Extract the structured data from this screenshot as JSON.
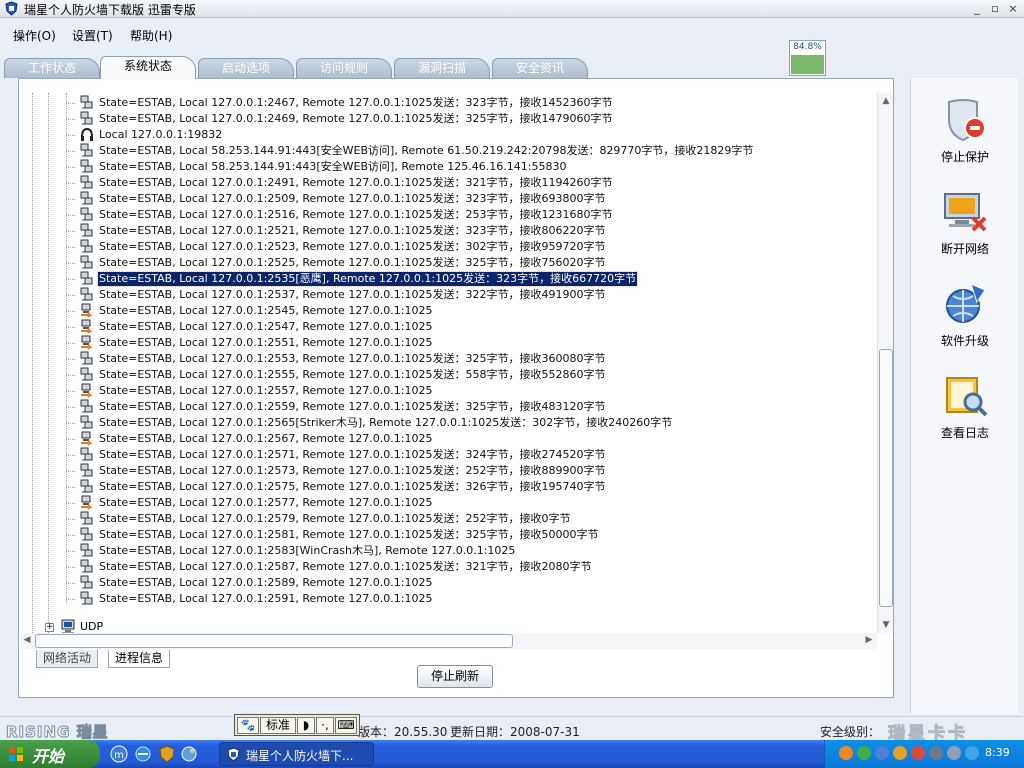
{
  "window": {
    "title": "瑞星个人防火墙下载版 迅雷专版",
    "min_label": "_",
    "max_label": "▫",
    "close_label": "×"
  },
  "menu": [
    "操作(O)",
    "设置(T)",
    "帮助(H)"
  ],
  "cpu_meter": {
    "label": "84.8%",
    "level_percent": 84.8
  },
  "tabs": [
    {
      "label": "工作状态",
      "active": false
    },
    {
      "label": "系统状态",
      "active": true
    },
    {
      "label": "启动选项",
      "active": false
    },
    {
      "label": "访问规则",
      "active": false
    },
    {
      "label": "漏洞扫描",
      "active": false
    },
    {
      "label": "安全资讯",
      "active": false
    }
  ],
  "connections": [
    {
      "icon": "connection",
      "text": "State=ESTAB, Local 127.0.0.1:2467, Remote 127.0.0.1:1025发送：323字节，接收1452360字节"
    },
    {
      "icon": "connection",
      "text": "State=ESTAB, Local 127.0.0.1:2469, Remote 127.0.0.1:1025发送：325字节，接收1479060字节"
    },
    {
      "icon": "listening",
      "text": "Local 127.0.0.1:19832"
    },
    {
      "icon": "connection",
      "text": "State=ESTAB, Local 58.253.144.91:443[安全WEB访问], Remote 61.50.219.242:20798发送：829770字节，接收21829字节"
    },
    {
      "icon": "connection",
      "text": "State=ESTAB, Local 58.253.144.91:443[安全WEB访问], Remote 125.46.16.141:55830"
    },
    {
      "icon": "connection",
      "text": "State=ESTAB, Local 127.0.0.1:2491, Remote 127.0.0.1:1025发送：321字节，接收1194260字节"
    },
    {
      "icon": "connection",
      "text": "State=ESTAB, Local 127.0.0.1:2509, Remote 127.0.0.1:1025发送：323字节，接收693800字节"
    },
    {
      "icon": "connection",
      "text": "State=ESTAB, Local 127.0.0.1:2516, Remote 127.0.0.1:1025发送：253字节，接收1231680字节"
    },
    {
      "icon": "connection",
      "text": "State=ESTAB, Local 127.0.0.1:2521, Remote 127.0.0.1:1025发送：323字节，接收806220字节"
    },
    {
      "icon": "connection",
      "text": "State=ESTAB, Local 127.0.0.1:2523, Remote 127.0.0.1:1025发送：302字节，接收959720字节"
    },
    {
      "icon": "connection",
      "text": "State=ESTAB, Local 127.0.0.1:2525, Remote 127.0.0.1:1025发送：325字节，接收756020字节"
    },
    {
      "icon": "connection",
      "text": "State=ESTAB, Local 127.0.0.1:2535[恶鹰], Remote 127.0.0.1:1025发送：323字节，接收667720字节",
      "selected": true
    },
    {
      "icon": "connection",
      "text": "State=ESTAB, Local 127.0.0.1:2537, Remote 127.0.0.1:1025发送：322字节，接收491900字节"
    },
    {
      "icon": "outgoing",
      "text": "State=ESTAB, Local 127.0.0.1:2545, Remote 127.0.0.1:1025"
    },
    {
      "icon": "outgoing",
      "text": "State=ESTAB, Local 127.0.0.1:2547, Remote 127.0.0.1:1025"
    },
    {
      "icon": "outgoing",
      "text": "State=ESTAB, Local 127.0.0.1:2551, Remote 127.0.0.1:1025"
    },
    {
      "icon": "connection",
      "text": "State=ESTAB, Local 127.0.0.1:2553, Remote 127.0.0.1:1025发送：325字节，接收360080字节"
    },
    {
      "icon": "connection",
      "text": "State=ESTAB, Local 127.0.0.1:2555, Remote 127.0.0.1:1025发送：558字节，接收552860字节"
    },
    {
      "icon": "outgoing",
      "text": "State=ESTAB, Local 127.0.0.1:2557, Remote 127.0.0.1:1025"
    },
    {
      "icon": "connection",
      "text": "State=ESTAB, Local 127.0.0.1:2559, Remote 127.0.0.1:1025发送：325字节，接收483120字节"
    },
    {
      "icon": "connection",
      "text": "State=ESTAB, Local 127.0.0.1:2565[Striker木马], Remote 127.0.0.1:1025发送：302字节，接收240260字节"
    },
    {
      "icon": "outgoing",
      "text": "State=ESTAB, Local 127.0.0.1:2567, Remote 127.0.0.1:1025"
    },
    {
      "icon": "connection",
      "text": "State=ESTAB, Local 127.0.0.1:2571, Remote 127.0.0.1:1025发送：324字节，接收274520字节"
    },
    {
      "icon": "connection",
      "text": "State=ESTAB, Local 127.0.0.1:2573, Remote 127.0.0.1:1025发送：252字节，接收889900字节"
    },
    {
      "icon": "connection",
      "text": "State=ESTAB, Local 127.0.0.1:2575, Remote 127.0.0.1:1025发送：326字节，接收195740字节"
    },
    {
      "icon": "outgoing",
      "text": "State=ESTAB, Local 127.0.0.1:2577, Remote 127.0.0.1:1025"
    },
    {
      "icon": "connection",
      "text": "State=ESTAB, Local 127.0.0.1:2579, Remote 127.0.0.1:1025发送：252字节，接收0字节"
    },
    {
      "icon": "connection",
      "text": "State=ESTAB, Local 127.0.0.1:2581, Remote 127.0.0.1:1025发送：325字节，接收50000字节"
    },
    {
      "icon": "connection",
      "text": "State=ESTAB, Local 127.0.0.1:2583[WinCrash木马], Remote 127.0.0.1:1025"
    },
    {
      "icon": "connection",
      "text": "State=ESTAB, Local 127.0.0.1:2587, Remote 127.0.0.1:1025发送：321字节，接收2080字节"
    },
    {
      "icon": "connection",
      "text": "State=ESTAB, Local 127.0.0.1:2589, Remote 127.0.0.1:1025"
    },
    {
      "icon": "connection",
      "text": "State=ESTAB, Local 127.0.0.1:2591, Remote 127.0.0.1:1025"
    }
  ],
  "udp_node": {
    "label": "UDP"
  },
  "subtabs": [
    {
      "label": "网络活动",
      "active": false
    },
    {
      "label": "进程信息",
      "active": true
    }
  ],
  "stop_refresh_label": "停止刷新",
  "side_buttons": [
    {
      "label": "停止保护",
      "icon": "shield-stop-icon"
    },
    {
      "label": "断开网络",
      "icon": "network-disconnect-icon"
    },
    {
      "label": "软件升级",
      "icon": "globe-update-icon"
    },
    {
      "label": "查看日志",
      "icon": "log-search-icon"
    }
  ],
  "status": {
    "logo": "RISING 瑞星",
    "version": "版本：20.55.30",
    "update_date": "更新日期：2008-07-31",
    "security_level": "安全级别：",
    "watermark": "瑞星卡卡",
    "watermark_url": "www.ikaka.com"
  },
  "ime": {
    "mode": "标准"
  },
  "taskbar": {
    "start_label": "开始",
    "task_label": "瑞星个人防火墙下...",
    "clock": "8:39"
  },
  "colors": {
    "selection": "#0a246a",
    "taskbar": "#245edb",
    "start": "#3c8f3c"
  }
}
